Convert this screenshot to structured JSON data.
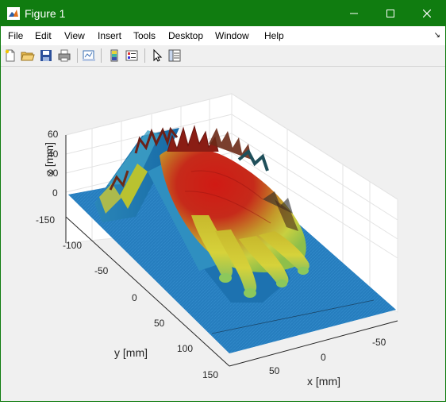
{
  "window": {
    "title": "Figure 1",
    "title_color": "#107c10"
  },
  "menu": [
    "File",
    "Edit",
    "View",
    "Insert",
    "Tools",
    "Desktop",
    "Window",
    "Help"
  ],
  "toolbar_icons": [
    "new-figure-icon",
    "open-file-icon",
    "save-icon",
    "print-icon",
    "link-plot-icon",
    "insert-colorbar-icon",
    "insert-legend-icon",
    "edit-plot-arrow-icon",
    "property-inspector-icon"
  ],
  "axes": {
    "x_label": "x [mm]",
    "y_label": "y [mm]",
    "z_label": "z [mm]",
    "x_ticks": [
      "50",
      "0",
      "-50"
    ],
    "y_ticks": [
      "-150",
      "-100",
      "-50",
      "0",
      "50",
      "100",
      "150"
    ],
    "z_ticks": [
      "60",
      "40",
      "20",
      "0"
    ],
    "grid": true
  },
  "plot": {
    "type": "surface",
    "subject": "hand scan",
    "colors": {
      "low": "#1f77b4",
      "mid": "#d8cc2a",
      "high": "#b81414"
    }
  }
}
